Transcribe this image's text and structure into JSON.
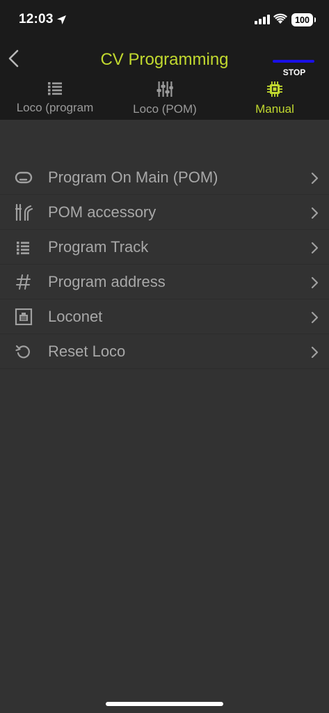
{
  "status_bar": {
    "time": "12:03",
    "battery": "100"
  },
  "nav": {
    "title": "CV Programming",
    "stop_label": "STOP"
  },
  "colors": {
    "accent": "#c1d82f",
    "stop_line": "#1a10e8",
    "background": "#323232",
    "header": "#1b1b1b"
  },
  "tabs": [
    {
      "label": "Loco (program",
      "icon": "list-icon",
      "active": false
    },
    {
      "label": "Loco (POM)",
      "icon": "sliders-icon",
      "active": false
    },
    {
      "label": "Manual",
      "icon": "chip-icon",
      "active": true
    }
  ],
  "menu": {
    "items": [
      {
        "label": "Program On Main (POM)",
        "icon": "loop-icon"
      },
      {
        "label": "POM accessory",
        "icon": "switch-icon"
      },
      {
        "label": "Program Track",
        "icon": "list-icon"
      },
      {
        "label": "Program address",
        "icon": "hash-icon"
      },
      {
        "label": "Loconet",
        "icon": "network-port-icon"
      },
      {
        "label": "Reset Loco",
        "icon": "reset-icon"
      }
    ]
  }
}
